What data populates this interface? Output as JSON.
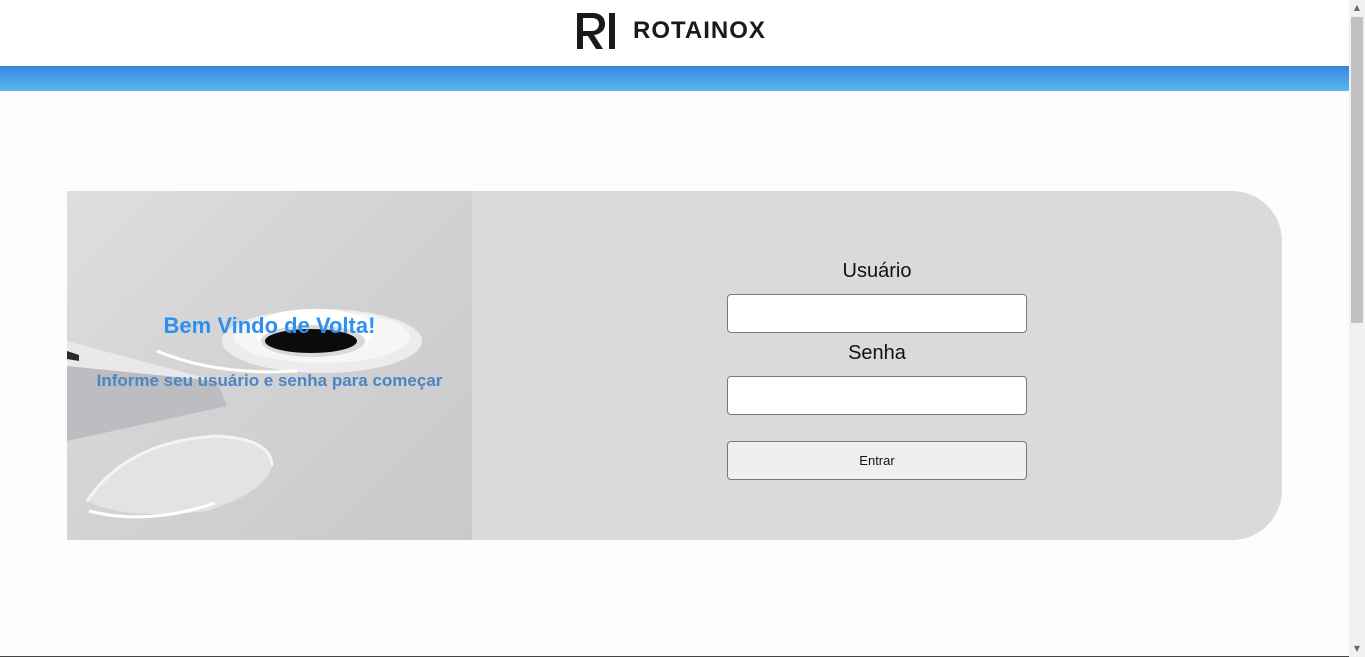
{
  "header": {
    "logo_text": "ROTAINOX",
    "logo_mark": "RI",
    "bar_color": "#4a9ee8"
  },
  "hero": {
    "title": "Bem Vindo de Volta!",
    "subtitle": "Informe seu usuário e senha para começar",
    "title_color": "#2d8ff0",
    "subtitle_color": "#4a86c2"
  },
  "login": {
    "user_label": "Usuário",
    "user_value": "",
    "pass_label": "Senha",
    "pass_value": "",
    "submit_label": "Entrar"
  },
  "icons": {
    "scroll_up": "scroll-up-arrow",
    "scroll_down": "scroll-down-arrow"
  }
}
